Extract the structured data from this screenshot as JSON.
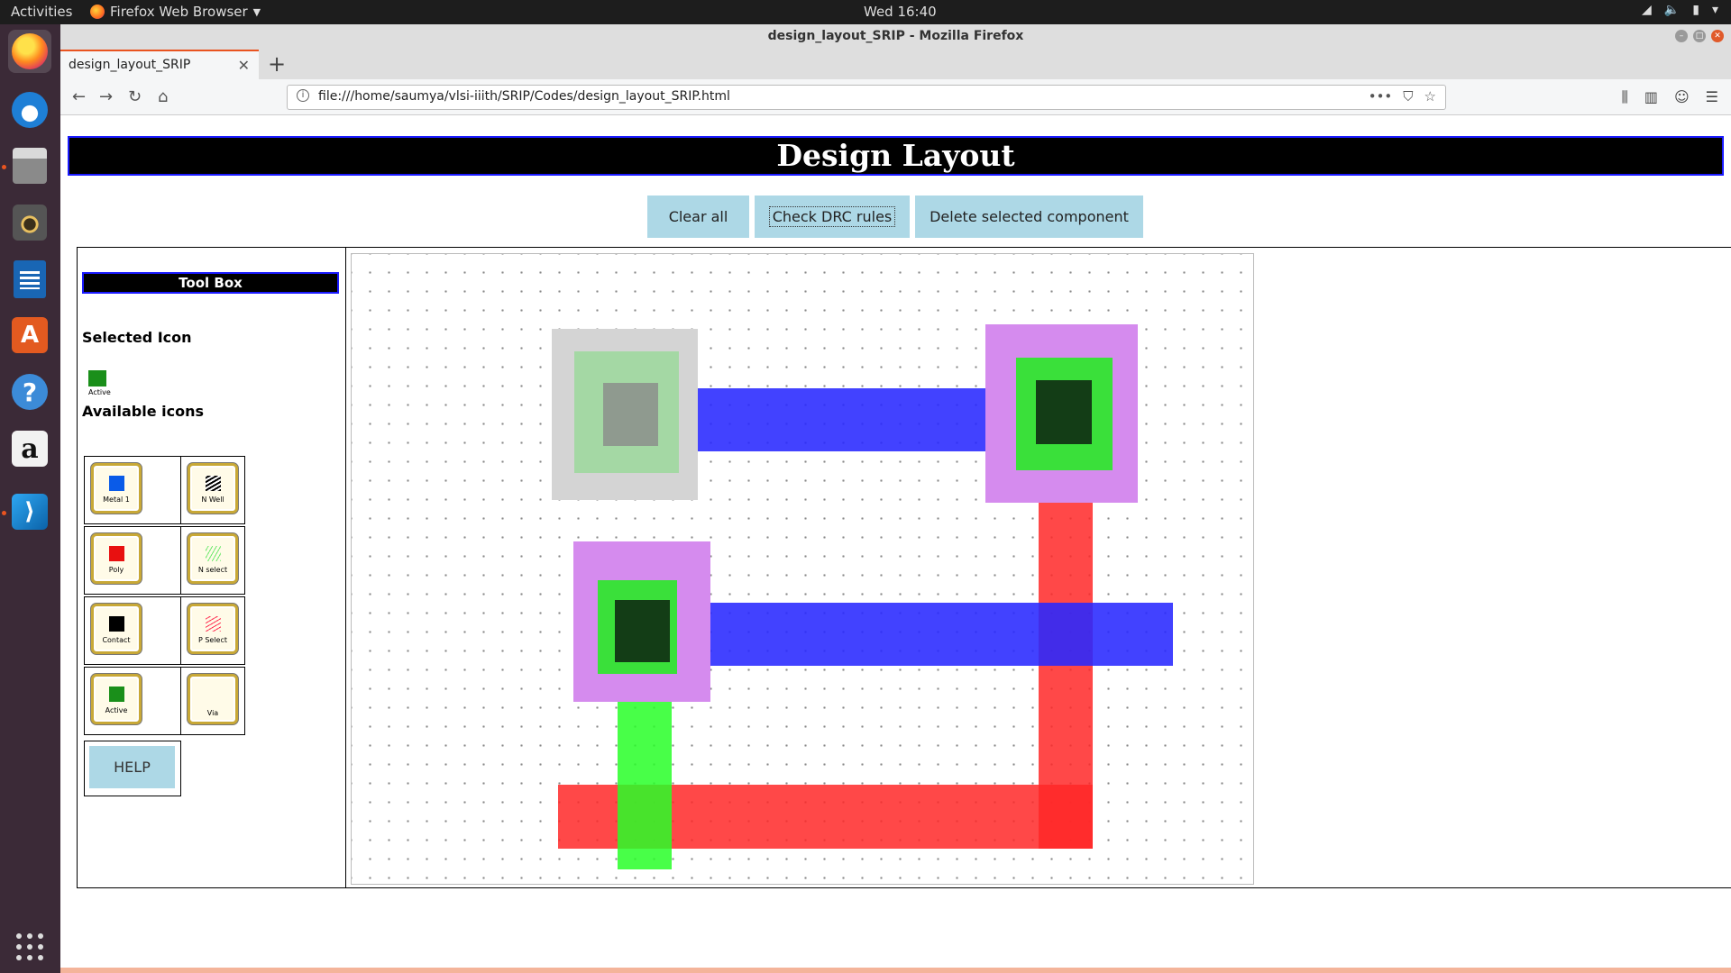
{
  "system": {
    "activities": "Activities",
    "app_menu": "Firefox Web Browser",
    "clock": "Wed 16:40"
  },
  "browser": {
    "window_title": "design_layout_SRIP - Mozilla Firefox",
    "tab_title": "design_layout_SRIP",
    "url": "file:///home/saumya/vlsi-iiith/SRIP/Codes/design_layout_SRIP.html"
  },
  "page": {
    "title": "Design Layout",
    "buttons": {
      "clear_all": "Clear all",
      "check_drc": "Check DRC rules",
      "delete_selected": "Delete selected component"
    },
    "toolbox": {
      "title": "Tool Box",
      "selected_heading": "Selected Icon",
      "selected_icon_label": "Active",
      "available_heading": "Available icons",
      "icons": {
        "metal1": "Metal 1",
        "nwell": "N Well",
        "poly": "Poly",
        "nselect": "N select",
        "contact": "Contact",
        "pselect": "P Select",
        "active": "Active",
        "via": "Via"
      },
      "help": "HELP"
    },
    "colors": {
      "metal1": "#0000ff",
      "poly": "#ff0000",
      "active": "#1a8f1a",
      "contact": "#000000",
      "nselect": "#00ee00",
      "pselect": "#ff3355",
      "via": "#ffffff",
      "nwell": "#000000"
    }
  }
}
